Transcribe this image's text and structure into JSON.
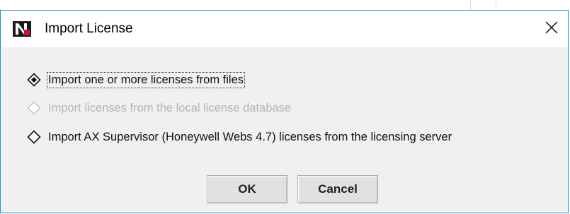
{
  "dialog": {
    "title": "Import License",
    "app_icon": "niagara-n-icon",
    "close_icon": "close-icon",
    "close_glyph": "✕"
  },
  "options": [
    {
      "label": "Import one or more licenses from files",
      "selected": true,
      "enabled": true
    },
    {
      "label": "Import licenses from the local license database",
      "selected": false,
      "enabled": false
    },
    {
      "label": "Import AX Supervisor (Honeywell Webs 4.7) licenses from the licensing server",
      "selected": false,
      "enabled": true
    }
  ],
  "buttons": {
    "ok": "OK",
    "cancel": "Cancel"
  },
  "colors": {
    "border_accent": "#1d8fd6",
    "content_bg": "#f0f0f0",
    "disabled_text": "#b5b5b5",
    "icon_red": "#c8102e"
  }
}
